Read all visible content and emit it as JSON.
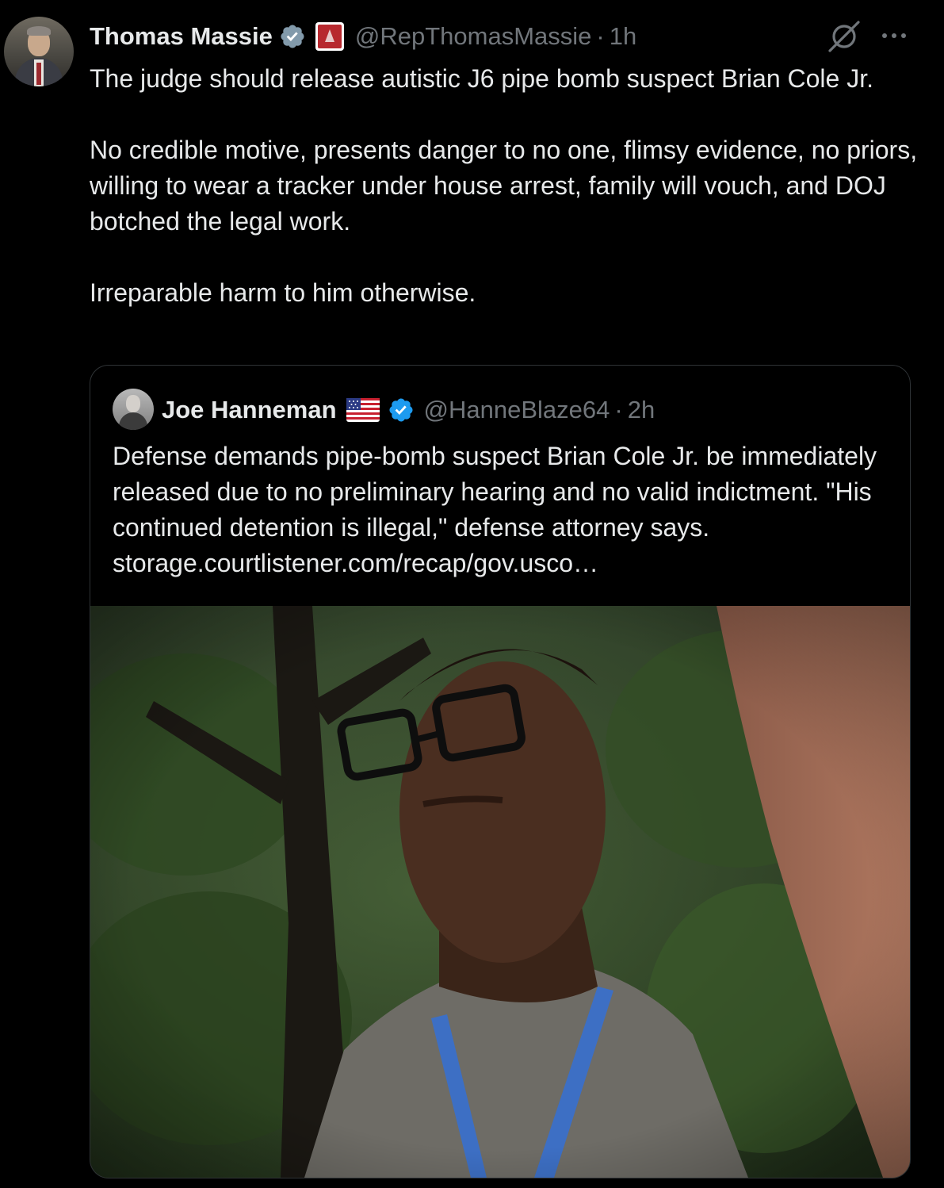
{
  "tweet": {
    "author": {
      "display_name": "Thomas Massie",
      "handle": "@RepThomasMassie",
      "separator": "·",
      "time": "1h",
      "verified_icon": "verified-badge-icon",
      "affiliation_icon": "us-house-affiliation-icon"
    },
    "body": {
      "paragraph_1": "The judge should release autistic J6 pipe bomb suspect Brian Cole Jr.",
      "paragraph_2": "No credible motive, presents danger to no one, flimsy evidence, no priors, willing to wear a tracker under house arrest, family will vouch, and DOJ  botched the legal work.",
      "paragraph_3": "Irreparable harm to him otherwise."
    },
    "actions": {
      "grok_icon": "grok-icon",
      "more_icon": "more-options-icon"
    }
  },
  "quoted_tweet": {
    "author": {
      "display_name": "Joe Hanneman",
      "flag_icon": "us-flag-icon",
      "handle": "@HanneBlaze64",
      "separator": "·",
      "time": "2h"
    },
    "text": "Defense demands pipe-bomb suspect Brian Cole Jr. be immediately released due to no preliminary hearing and no valid indictment. \"His continued detention is illegal,\" defense attorney says. storage.courtlistener.com/recap/gov.usco…",
    "media": {
      "type": "photo"
    }
  },
  "colors": {
    "background": "#000000",
    "text_primary": "#e7e9ea",
    "text_secondary": "#71767b",
    "border": "#2f3336",
    "verified_blue": "#1d9bf0",
    "verified_gray": "#829aab"
  }
}
